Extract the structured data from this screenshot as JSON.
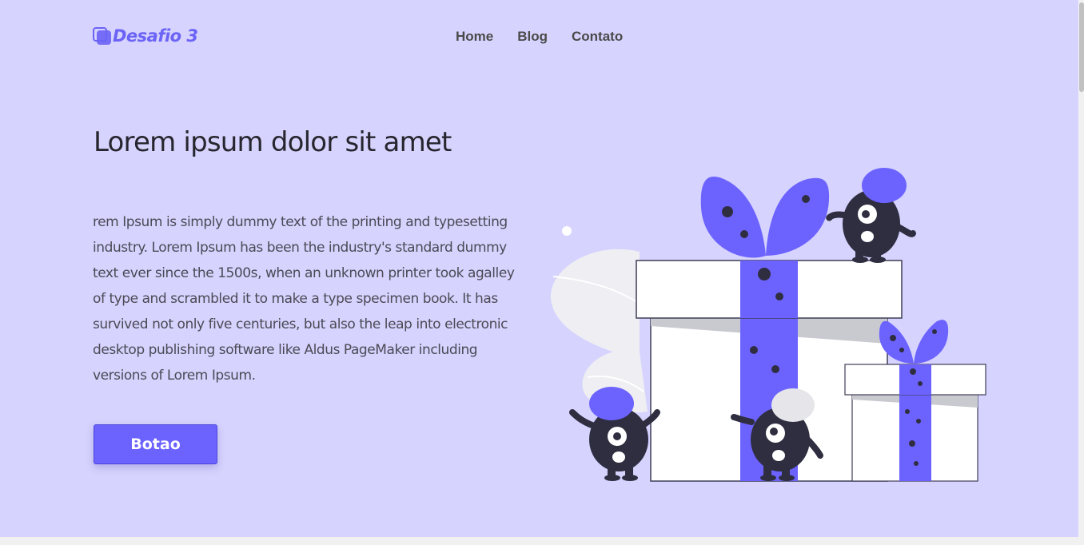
{
  "header": {
    "logo_text": "Desafio 3",
    "nav": [
      {
        "label": "Home"
      },
      {
        "label": "Blog"
      },
      {
        "label": "Contato"
      }
    ]
  },
  "hero": {
    "title": "Lorem ipsum dolor sit amet",
    "description": "rem Ipsum is simply dummy text of the printing and typesetting industry. Lorem Ipsum has been the industry's standard dummy text ever since the 1500s, when an unknown printer took agalley of type and scrambled it to make a type specimen book. It has survived not only five centuries, but also the leap into electronic desktop publishing software like Aldus PageMaker including versions of Lorem Ipsum.",
    "button_label": "Botao"
  },
  "colors": {
    "background": "#d6d3fe",
    "accent": "#6c63ff",
    "dark": "#2f2e41"
  },
  "illustration": {
    "icon": "gift-boxes-with-monsters-illustration"
  }
}
